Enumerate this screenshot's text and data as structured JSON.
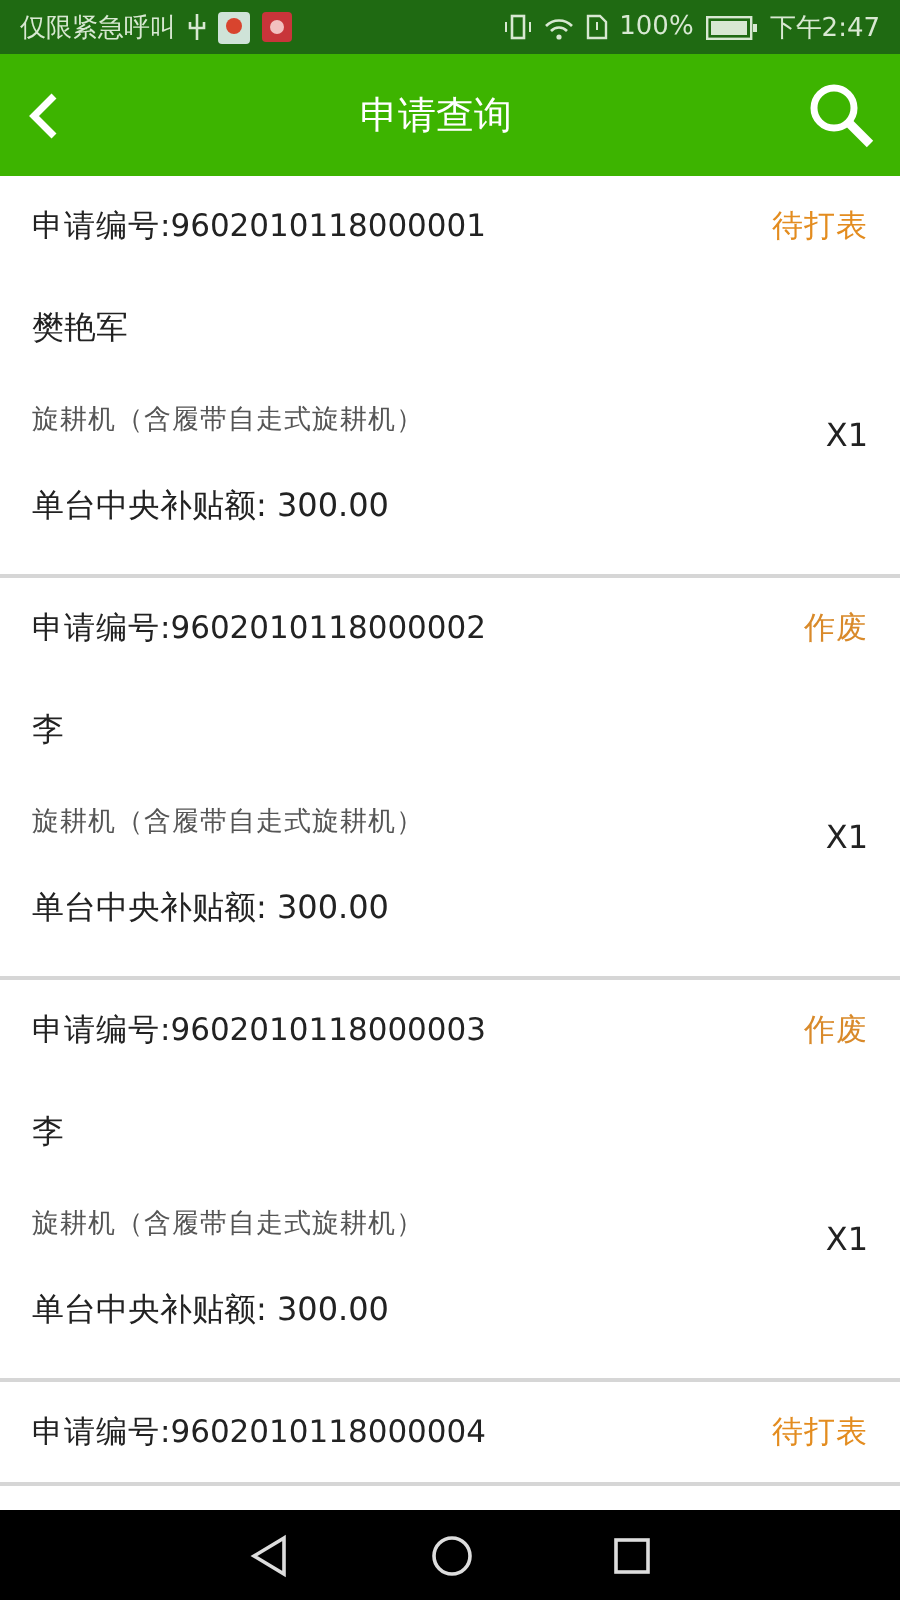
{
  "status_bar": {
    "carrier": "仅限紧急呼叫",
    "battery": "100%",
    "time": "下午2:47"
  },
  "header": {
    "title": "申请查询"
  },
  "applications": [
    {
      "number": "申请编号:9602010118000001",
      "status": "待打表",
      "kind": "pending",
      "name": "樊艳军",
      "product": "旋耕机（含履带自走式旋耕机）",
      "quantity": "X1",
      "subsidy": "单台中央补贴额: 300.00"
    },
    {
      "number": "申请编号:9602010118000002",
      "status": "作废",
      "kind": "void",
      "name": "李",
      "product": "旋耕机（含履带自走式旋耕机）",
      "quantity": "X1",
      "subsidy": "单台中央补贴额: 300.00"
    },
    {
      "number": "申请编号:9602010118000003",
      "status": "作废",
      "kind": "void",
      "name": "李",
      "product": "旋耕机（含履带自走式旋耕机）",
      "quantity": "X1",
      "subsidy": "单台中央补贴额: 300.00"
    },
    {
      "number": "申请编号:9602010118000004",
      "status": "待打表",
      "kind": "pending"
    }
  ]
}
